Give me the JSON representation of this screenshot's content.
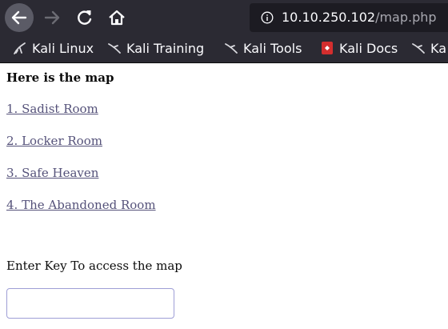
{
  "browser": {
    "url_host": "10.10.250.102",
    "url_path": "/map.php",
    "theme": {
      "toolbar_bg": "#2b2a33",
      "url_bg": "#1c1b22",
      "text": "#fbfbfe"
    },
    "nav_icons": [
      "back-arrow-icon",
      "forward-arrow-icon",
      "reload-icon",
      "home-icon",
      "info-icon"
    ]
  },
  "bookmarks": [
    {
      "label": "Kali Linux",
      "icon": "kali-dragon-icon"
    },
    {
      "label": "Kali Training",
      "icon": "kali-dragon-icon"
    },
    {
      "label": "Kali Tools",
      "icon": "kali-dragon-icon"
    },
    {
      "label": "Kali Docs",
      "icon": "kali-docs-icon"
    },
    {
      "label": "Ka",
      "icon": "kali-dragon-icon"
    }
  ],
  "page": {
    "heading": "Here is the map",
    "links": [
      "1. Sadist Room",
      "2. Locker Room",
      "3. Safe Heaven",
      "4. The Abandoned Room"
    ],
    "link_color": "#55527a",
    "key_label": "Enter Key To access the map",
    "key_value": "",
    "key_placeholder": ""
  }
}
